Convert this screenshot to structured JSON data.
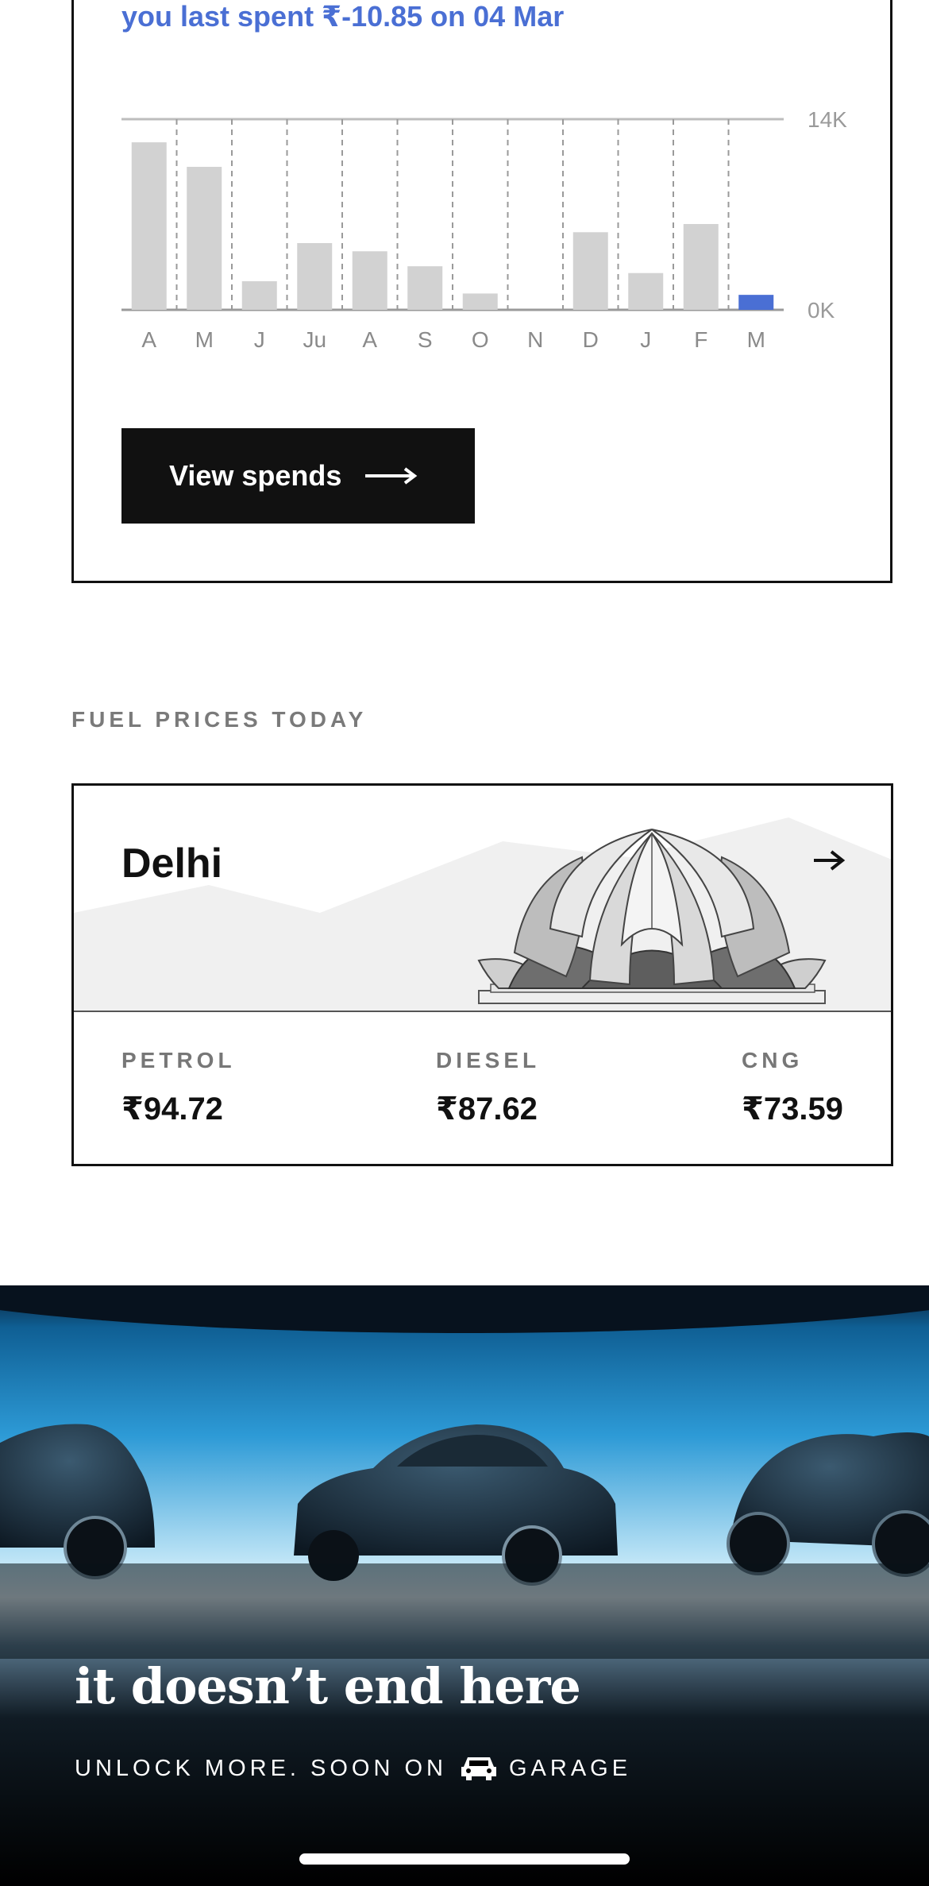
{
  "spends": {
    "last_spent_text": "you last spent ₹-10.85 on 04 Mar",
    "view_button_label": "View spends",
    "accent_color": "#4a6fd4"
  },
  "chart_data": {
    "type": "bar",
    "categories": [
      "A",
      "M",
      "J",
      "Ju",
      "A",
      "S",
      "O",
      "N",
      "D",
      "J",
      "F",
      "M"
    ],
    "values": [
      12300,
      10500,
      2100,
      4900,
      4300,
      3200,
      1200,
      0,
      5700,
      2700,
      6300,
      1100
    ],
    "highlight_index": 11,
    "ylim": [
      0,
      14000
    ],
    "y_tick_labels": [
      "14K",
      "0K"
    ],
    "bar_color": "#d2d2d2",
    "highlight_color": "#4a6fd4",
    "grid": "dashed vertical separators"
  },
  "fuel": {
    "section_title": "FUEL PRICES TODAY",
    "city": "Delhi",
    "items": [
      {
        "label": "PETROL",
        "price": "₹94.72"
      },
      {
        "label": "DIESEL",
        "price": "₹87.62"
      },
      {
        "label": "CNG",
        "price": "₹73.59"
      }
    ],
    "illustration_icon": "lotus-temple-icon"
  },
  "banner": {
    "headline": "it doesn’t end here",
    "sub_prefix": "UNLOCK MORE. SOON ON",
    "sub_brand": "GARAGE",
    "brand_icon": "car-icon"
  }
}
